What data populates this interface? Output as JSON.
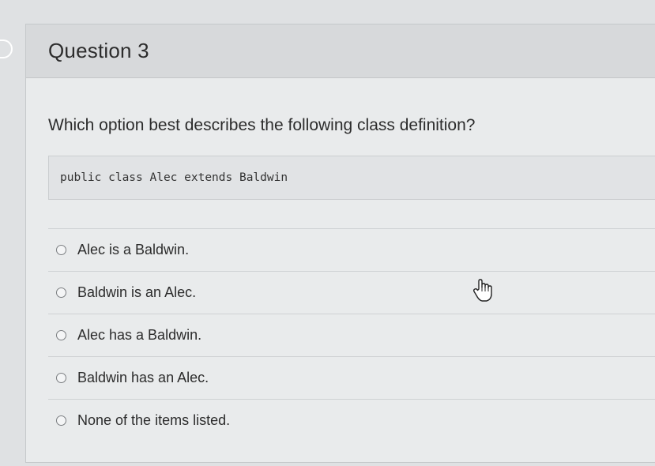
{
  "question": {
    "title": "Question 3",
    "prompt": "Which option best describes the following class definition?",
    "code": "public class Alec extends Baldwin"
  },
  "answers": [
    {
      "label": "Alec is a Baldwin.",
      "selected": false
    },
    {
      "label": "Baldwin is an Alec.",
      "selected": false
    },
    {
      "label": "Alec has a Baldwin.",
      "selected": false
    },
    {
      "label": "Baldwin has an Alec.",
      "selected": false
    },
    {
      "label": "None of the items listed.",
      "selected": false
    }
  ],
  "icons": {
    "flag": "flag-question-icon",
    "cursor": "hand-pointer-icon"
  },
  "colors": {
    "background": "#dfe1e3",
    "header": "#d7d9db",
    "text": "#2c2c2c"
  }
}
